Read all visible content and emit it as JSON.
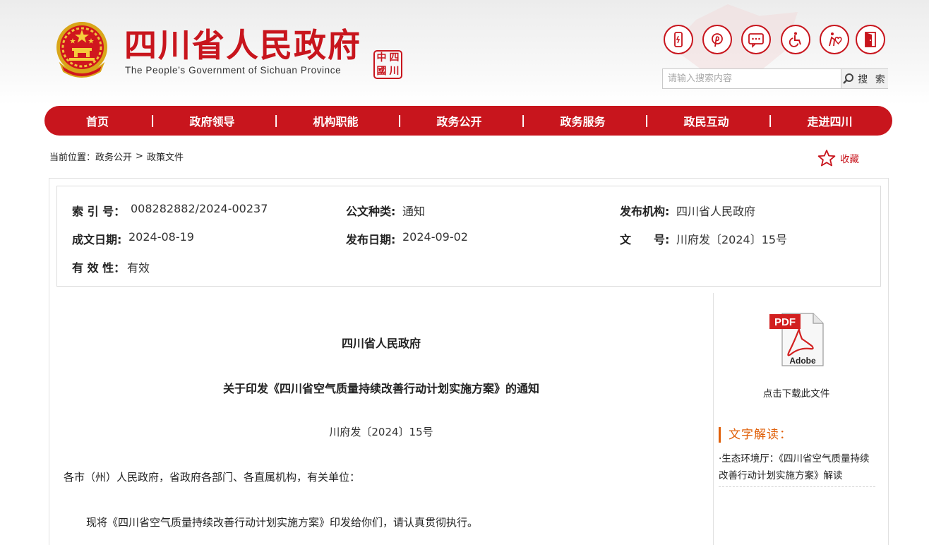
{
  "header": {
    "title": "四川省人民政府",
    "subtitle": "The People’s Government of Sichuan Province",
    "seal_chars": [
      "中",
      "四",
      "國",
      "川"
    ],
    "icons": [
      "mobile-icon",
      "weibo-icon",
      "chat-icon",
      "accessibility-icon",
      "elderly-care-icon",
      "exit-door-icon"
    ],
    "search": {
      "placeholder": "请输入搜索内容",
      "button_label": "搜 索"
    }
  },
  "nav": {
    "items": [
      "首页",
      "政府领导",
      "机构职能",
      "政务公开",
      "政务服务",
      "政民互动",
      "走进四川"
    ],
    "separator": "|"
  },
  "breadcrumb": {
    "prefix": "当前位置：",
    "items": [
      "政务公开",
      "政策文件"
    ],
    "arrow": ">"
  },
  "favorite_label": "收藏",
  "meta": {
    "index_label": "索 引 号：",
    "index_value": "008282882/2024-00237",
    "doc_type_label": "公文种类:",
    "doc_type_value": "通知",
    "publisher_label": "发布机构:",
    "publisher_value": "四川省人民政府",
    "created_label": "成文日期:",
    "created_value": "2024-08-19",
    "published_label": "发布日期:",
    "published_value": "2024-09-02",
    "docno_label": "文　　号:",
    "docno_value": "川府发〔2024〕15号",
    "validity_label": "有 效 性：",
    "validity_value": "有效"
  },
  "document": {
    "issuer": "四川省人民政府",
    "title": "关于印发《四川省空气质量持续改善行动计划实施方案》的通知",
    "number": "川府发〔2024〕15号",
    "salutation": "各市（州）人民政府，省政府各部门、各直属机构，有关单位：",
    "body": "现将《四川省空气质量持续改善行动计划实施方案》印发给你们，请认真贯彻执行。"
  },
  "sidebar": {
    "pdf_badge": "PDF",
    "pdf_brand": "Adobe",
    "download_label": "点击下载此文件",
    "interpretation_heading": "文字解读：",
    "interpretation_link": "·生态环境厅：《四川省空气质量持续改善行动计划实施方案》解读"
  },
  "colors": {
    "brand_red": "#c8151d",
    "accent_orange": "#e0600a"
  }
}
